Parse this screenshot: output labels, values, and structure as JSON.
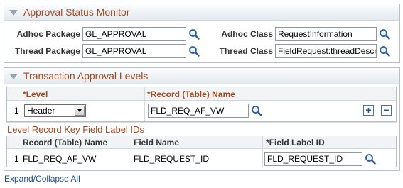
{
  "approval_status": {
    "title": "Approval Status Monitor",
    "adhoc_package_label": "Adhoc Package",
    "adhoc_package_value": "GL_APPROVAL",
    "adhoc_class_label": "Adhoc Class",
    "adhoc_class_value": "RequestInformation",
    "thread_package_label": "Thread Package",
    "thread_package_value": "GL_APPROVAL",
    "thread_class_label": "Thread Class",
    "thread_class_value": "FieldRequest:threadDescr"
  },
  "levels": {
    "title": "Transaction Approval Levels",
    "col_level": "*Level",
    "col_record": "*Record (Table) Name",
    "row_number": "1",
    "level_value": "Header",
    "record_value": "FLD_REQ_AF_VW",
    "add_symbol": "+",
    "remove_symbol": "−"
  },
  "key_fields": {
    "title": "Level Record Key Field Label IDs",
    "col_record": "Record (Table) Name",
    "col_field": "Field Name",
    "col_label": "*Field Label ID",
    "row_number": "1",
    "record_value": "FLD_REQ_AF_VW",
    "field_value": "FLD_REQUEST_ID",
    "label_value": "FLD_REQUEST_ID"
  },
  "footer": {
    "expand_collapse": "Expand/Collapse All"
  },
  "icons": {
    "lookup": "magnifier-icon",
    "collapse": "triangle-down-icon"
  },
  "colors": {
    "section_title": "#a04a22",
    "link": "#1f4f9a"
  }
}
